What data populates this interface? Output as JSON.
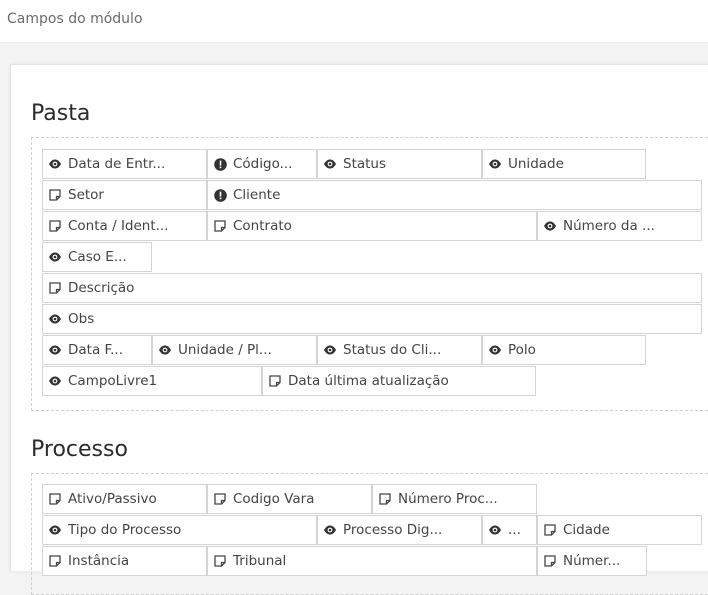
{
  "page": {
    "title": "Campos do módulo"
  },
  "sections": [
    {
      "title": "Pasta",
      "fields": [
        {
          "label": "Data de Entr...",
          "icon": "eye-icon"
        },
        {
          "label": "Código...",
          "icon": "alert-icon"
        },
        {
          "label": "Status",
          "icon": "eye-icon"
        },
        {
          "label": "Unidade",
          "icon": "eye-icon"
        },
        {
          "label": "Setor",
          "icon": "note-icon"
        },
        {
          "label": "Cliente",
          "icon": "alert-icon"
        },
        {
          "label": "Conta / Ident...",
          "icon": "note-icon"
        },
        {
          "label": "Contrato",
          "icon": "note-icon"
        },
        {
          "label": "Número da ...",
          "icon": "eye-icon"
        },
        {
          "label": "Caso E...",
          "icon": "eye-icon"
        },
        {
          "label": "Descrição",
          "icon": "note-icon"
        },
        {
          "label": "Obs",
          "icon": "eye-icon"
        },
        {
          "label": "Data F...",
          "icon": "eye-icon"
        },
        {
          "label": "Unidade / Pl...",
          "icon": "eye-icon"
        },
        {
          "label": "Status do Cli...",
          "icon": "eye-icon"
        },
        {
          "label": "Polo",
          "icon": "eye-icon"
        },
        {
          "label": "CampoLivre1",
          "icon": "eye-icon"
        },
        {
          "label": "Data última atualização",
          "icon": "note-icon"
        }
      ]
    },
    {
      "title": "Processo",
      "fields": [
        {
          "label": "Ativo/Passivo",
          "icon": "note-icon"
        },
        {
          "label": "Codigo Vara",
          "icon": "note-icon"
        },
        {
          "label": "Número Proc...",
          "icon": "note-icon"
        },
        {
          "label": "Tipo do Processo",
          "icon": "eye-icon"
        },
        {
          "label": "Processo Dig...",
          "icon": "eye-icon"
        },
        {
          "label": "...",
          "icon": "eye-icon"
        },
        {
          "label": "Cidade",
          "icon": "note-icon"
        },
        {
          "label": "Instância",
          "icon": "note-icon"
        },
        {
          "label": "Tribunal",
          "icon": "note-icon"
        },
        {
          "label": "Númer...",
          "icon": "note-icon"
        }
      ]
    }
  ]
}
